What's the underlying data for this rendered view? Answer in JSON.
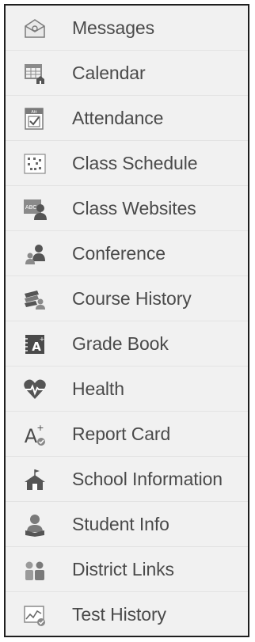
{
  "sidebar": {
    "items": [
      {
        "label": "Messages",
        "icon": "envelope-icon"
      },
      {
        "label": "Calendar",
        "icon": "calendar-icon"
      },
      {
        "label": "Attendance",
        "icon": "attendance-check-icon"
      },
      {
        "label": "Class Schedule",
        "icon": "schedule-grid-icon"
      },
      {
        "label": "Class Websites",
        "icon": "class-website-icon"
      },
      {
        "label": "Conference",
        "icon": "conference-people-icon"
      },
      {
        "label": "Course History",
        "icon": "books-history-icon"
      },
      {
        "label": "Grade Book",
        "icon": "gradebook-icon"
      },
      {
        "label": "Health",
        "icon": "heart-pulse-icon"
      },
      {
        "label": "Report Card",
        "icon": "report-card-grade-icon"
      },
      {
        "label": "School Information",
        "icon": "school-house-icon"
      },
      {
        "label": "Student Info",
        "icon": "student-reading-icon"
      },
      {
        "label": "District Links",
        "icon": "people-group-icon"
      },
      {
        "label": "Test History",
        "icon": "test-chart-icon"
      }
    ]
  },
  "colors": {
    "sidebar_background": "#f1f1f1",
    "border": "#1f1f1f",
    "row_divider": "#e3e3e3",
    "text": "#4a4a4a",
    "icon": "#6a6a6a"
  }
}
